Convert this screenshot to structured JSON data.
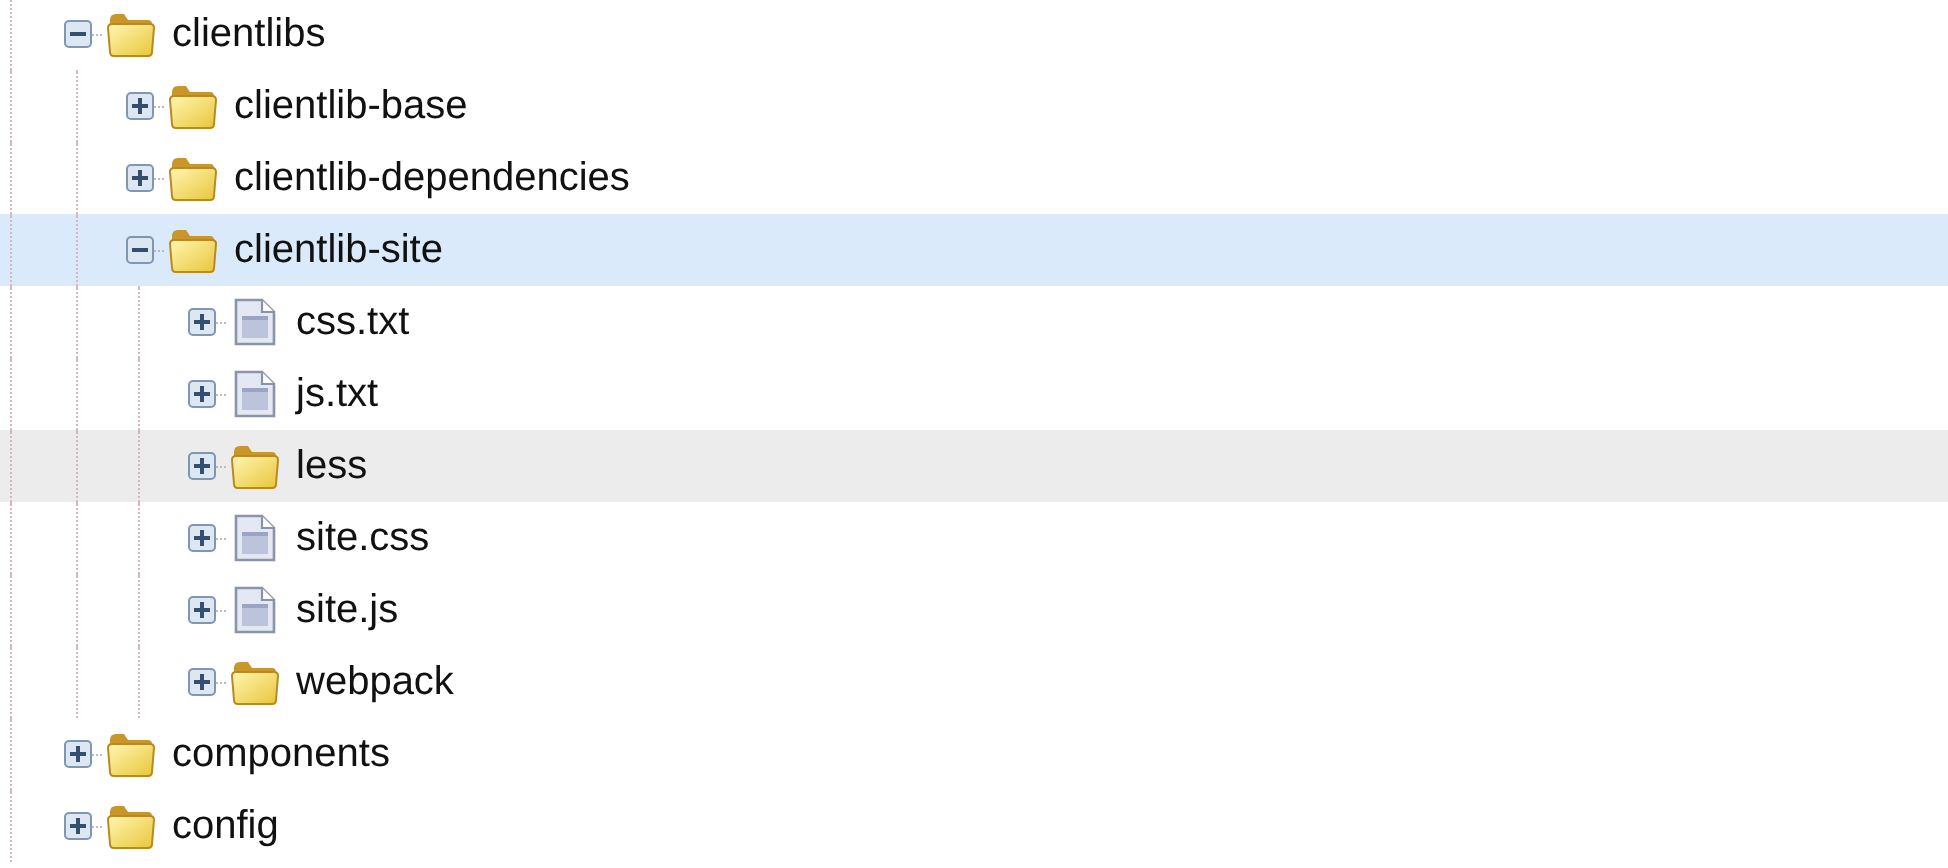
{
  "tree": {
    "items": [
      {
        "label": "clientlibs",
        "kind": "folder",
        "expanded": true,
        "selected": false,
        "hovered": false,
        "children": [
          {
            "label": "clientlib-base",
            "kind": "folder",
            "expanded": false,
            "selected": false,
            "hovered": false
          },
          {
            "label": "clientlib-dependencies",
            "kind": "folder",
            "expanded": false,
            "selected": false,
            "hovered": false
          },
          {
            "label": "clientlib-site",
            "kind": "folder",
            "expanded": true,
            "selected": true,
            "hovered": false,
            "children": [
              {
                "label": "css.txt",
                "kind": "file",
                "expanded": false,
                "selected": false,
                "hovered": false
              },
              {
                "label": "js.txt",
                "kind": "file",
                "expanded": false,
                "selected": false,
                "hovered": false
              },
              {
                "label": "less",
                "kind": "folder",
                "expanded": false,
                "selected": false,
                "hovered": true
              },
              {
                "label": "site.css",
                "kind": "file",
                "expanded": false,
                "selected": false,
                "hovered": false
              },
              {
                "label": "site.js",
                "kind": "file",
                "expanded": false,
                "selected": false,
                "hovered": false
              },
              {
                "label": "webpack",
                "kind": "folder",
                "expanded": false,
                "selected": false,
                "hovered": false
              }
            ]
          }
        ]
      },
      {
        "label": "components",
        "kind": "folder",
        "expanded": false,
        "selected": false,
        "hovered": false
      },
      {
        "label": "config",
        "kind": "folder",
        "expanded": false,
        "selected": false,
        "hovered": false
      }
    ]
  }
}
